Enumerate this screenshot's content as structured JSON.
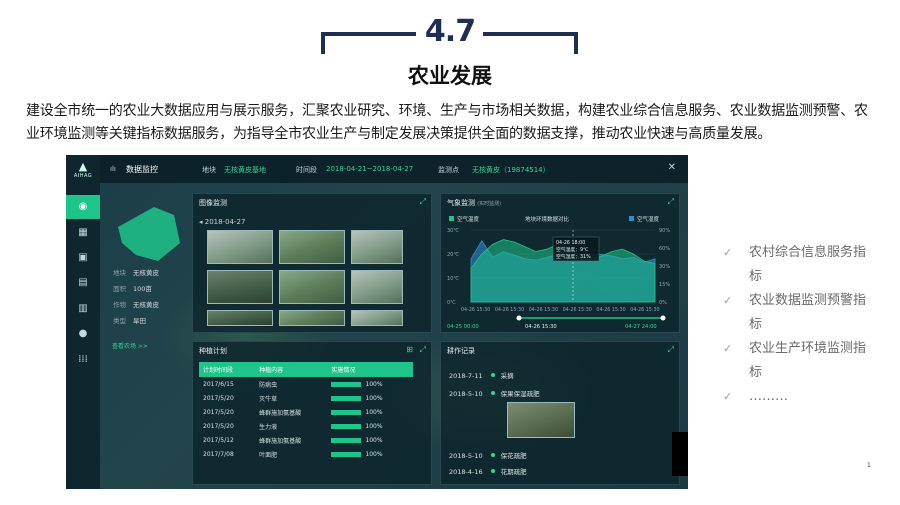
{
  "header": {
    "section_number": "4.7",
    "section_title": "农业发展",
    "intro": "建设全市统一的农业大数据应用与展示服务，汇聚农业研究、环境、生产与市场相关数据，构建农业综合信息服务、农业数据监测预警、农业环境监测等关键指标数据服务，为指导全市农业生产与制定发展决策提供全面的数据支撑，推动农业快速与高质量发展。"
  },
  "dashboard": {
    "brand": "AIHAG",
    "title": "数据监控",
    "filters": {
      "base_label": "地块",
      "base_value": "无核黄皮基地",
      "time_label": "时间段",
      "time_value": "2018-04-21~2018-04-27",
      "point_label": "监测点",
      "point_value": "无核黄皮（19874514）"
    },
    "farm": {
      "rows": [
        {
          "label": "地块",
          "value": "无核黄皮"
        },
        {
          "label": "面积",
          "value": "100亩"
        },
        {
          "label": "作物",
          "value": "无核黄皮"
        },
        {
          "label": "类型",
          "value": "旱田"
        }
      ],
      "link": "查看农场 >>"
    },
    "image_panel": {
      "title": "图像监测",
      "date": "◂ 2018-04-27"
    },
    "weather_panel": {
      "title": "气象监测",
      "subtitle": "(实时监测)",
      "legend_left": "空气温度",
      "chart_title": "地块环境数据对比",
      "legend_right": "空气湿度",
      "tooltip": [
        "04-26 18:00",
        "空气温度：9℃",
        "空气湿度：31%"
      ],
      "range_start": "04-25  00:00",
      "range_mid": "04-26  15:30",
      "range_end": "04-27  24:00"
    },
    "plan_panel": {
      "title": "种植计划",
      "columns": [
        "计划时间段",
        "种植内容",
        "实施情况"
      ],
      "rows": [
        [
          "2017/6/15",
          "防病虫",
          "100%"
        ],
        [
          "2017/5/20",
          "灭牛草",
          "100%"
        ],
        [
          "2017/5/20",
          "蜂群施加氨基酸",
          "100%"
        ],
        [
          "2017/5/20",
          "生力液",
          "100%"
        ],
        [
          "2017/5/12",
          "蜂群施加氨基酸",
          "100%"
        ],
        [
          "2017/7/08",
          "叶面肥",
          "100%"
        ]
      ]
    },
    "log_panel": {
      "title": "耕作记录",
      "items": [
        {
          "date": "2018-7-11",
          "text": "采摘"
        },
        {
          "date": "2018-5-10",
          "text": "保果保湿疏肥"
        },
        {
          "date": "2018-5-10",
          "text": "保花疏肥"
        },
        {
          "date": "2018-4-16",
          "text": "花期疏肥"
        }
      ]
    }
  },
  "chart_data": {
    "type": "area",
    "title": "地块环境数据对比",
    "series": [
      {
        "name": "空气温度",
        "values": [
          14,
          20,
          24,
          26,
          25,
          23,
          21,
          22,
          24,
          23,
          20,
          18,
          19,
          21,
          22,
          20,
          17,
          16
        ]
      },
      {
        "name": "空气湿度",
        "values": [
          60,
          85,
          62,
          70,
          65,
          60,
          58,
          62,
          66,
          64,
          63,
          65,
          66,
          64,
          60,
          62,
          55,
          60
        ]
      }
    ],
    "x_ticks": [
      "04-26 15:30",
      "04-26 15:30",
      "04-26 15:30",
      "04-26 15:30",
      "04-26 15:30",
      "04-26 15:30"
    ],
    "y_left_ticks": [
      "30℃",
      "20℃",
      "10℃",
      "0℃"
    ],
    "y_right_ticks": [
      "90%",
      "60%",
      "30%",
      "15%",
      "0%"
    ],
    "ylim_temp": [
      0,
      30
    ],
    "ylim_humidity": [
      0,
      100
    ],
    "colors": {
      "temp": "#1ec48a",
      "humidity": "#2f8fd6"
    }
  },
  "checklist": [
    "农村综合信息服务指标",
    "农业数据监测预警指标",
    "农业生产环境监测指标",
    "………"
  ],
  "stray_mark": "1"
}
